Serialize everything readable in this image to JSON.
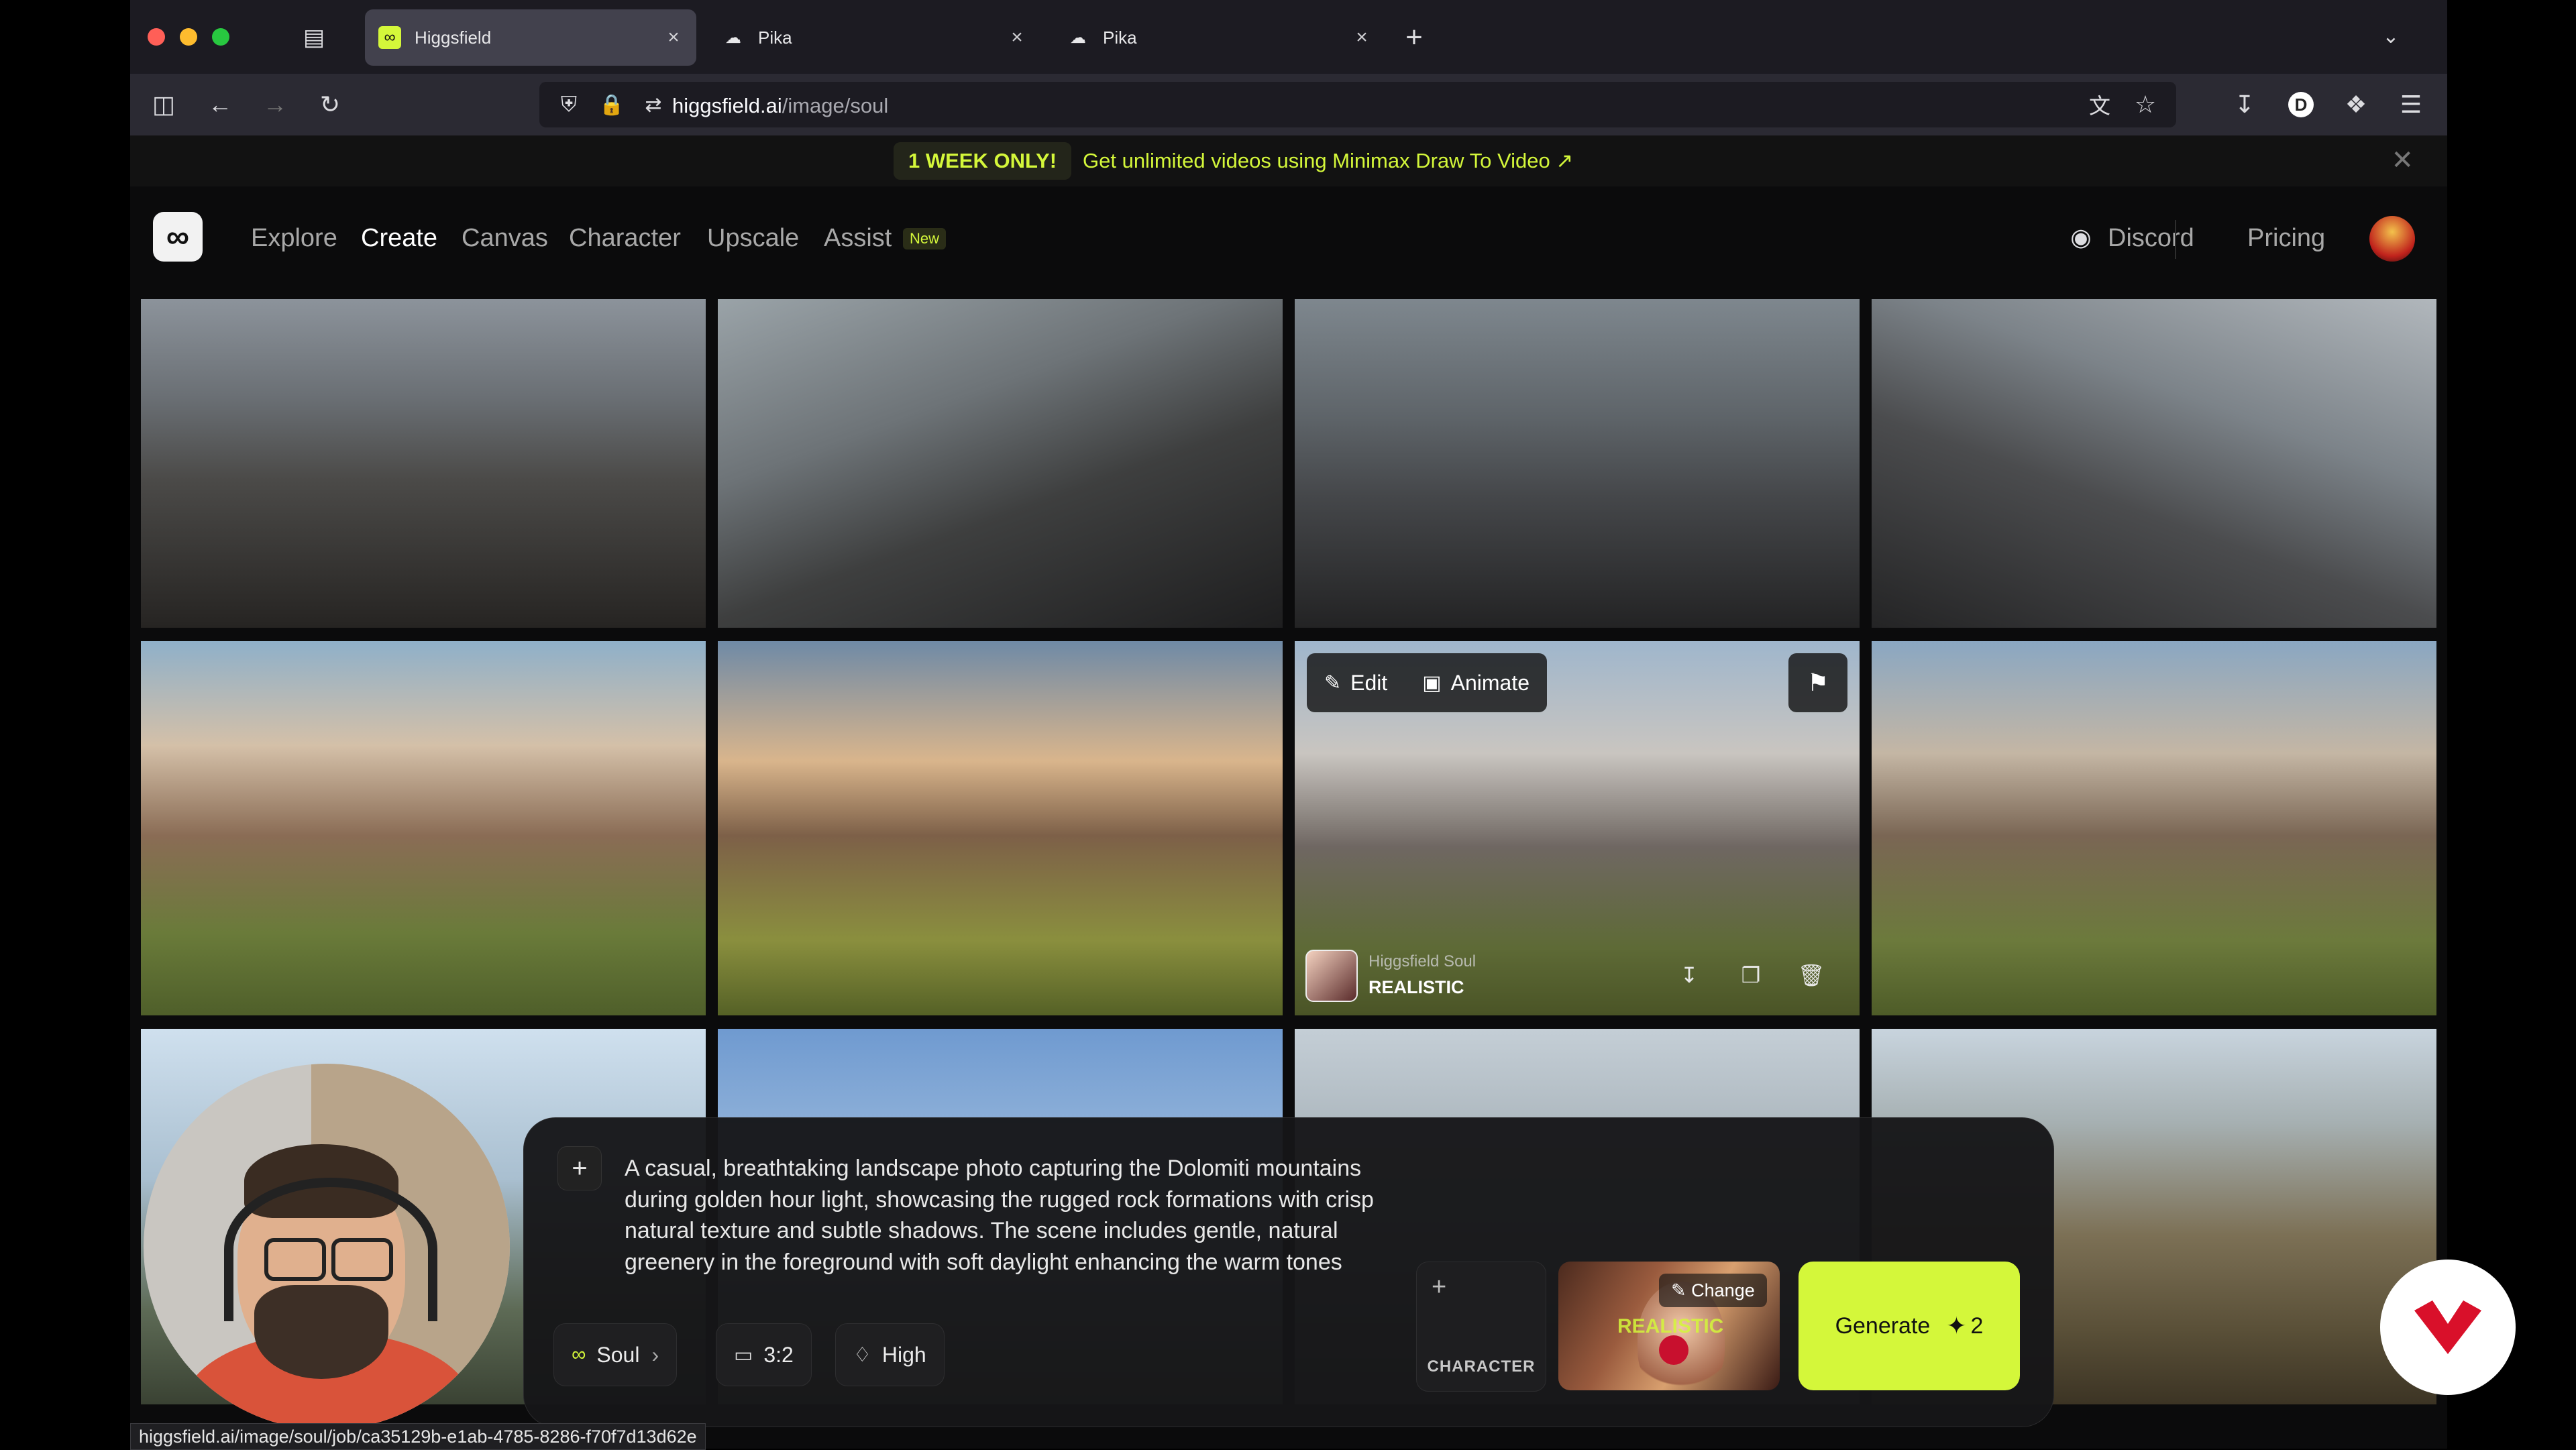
{
  "browser": {
    "tabs": [
      {
        "title": "Higgsfield",
        "active": true
      },
      {
        "title": "Pika",
        "active": false
      },
      {
        "title": "Pika",
        "active": false
      }
    ],
    "url_domain": "higgsfield.ai",
    "url_path": "/image/soul",
    "status_url": "higgsfield.ai/image/soul/job/ca35129b-e1ab-4785-8286-f70f7d13d62e"
  },
  "banner": {
    "badge": "1 WEEK ONLY!",
    "text": "Get unlimited videos using Minimax Draw To Video ↗"
  },
  "nav": {
    "items": [
      "Explore",
      "Create",
      "Canvas",
      "Character",
      "Upscale",
      "Assist"
    ],
    "active": "Create",
    "new_badge": "New",
    "discord": "Discord",
    "pricing": "Pricing"
  },
  "tile_overlay": {
    "edit": "Edit",
    "animate": "Animate",
    "model": "Higgsfield Soul",
    "style": "REALISTIC"
  },
  "prompt": {
    "text": "A casual, breathtaking landscape photo capturing the Dolomiti mountains during golden hour light, showcasing the rugged rock formations with crisp natural texture and subtle shadows. The scene includes gentle, natural greenery in the foreground with soft daylight enhancing the warm tones and atmospheric depth. The composition is slightly tilted, emulating the unplanned, genuine feel of an iPhone",
    "model_chip": "Soul",
    "ratio_chip": "3:2",
    "quality_chip": "High",
    "character_label": "CHARACTER",
    "style_change": "Change",
    "style_label": "REALISTIC",
    "generate_label": "Generate",
    "generate_cost": "2"
  },
  "colors": {
    "accent": "#d4f73a",
    "background": "#0b0b0c"
  }
}
